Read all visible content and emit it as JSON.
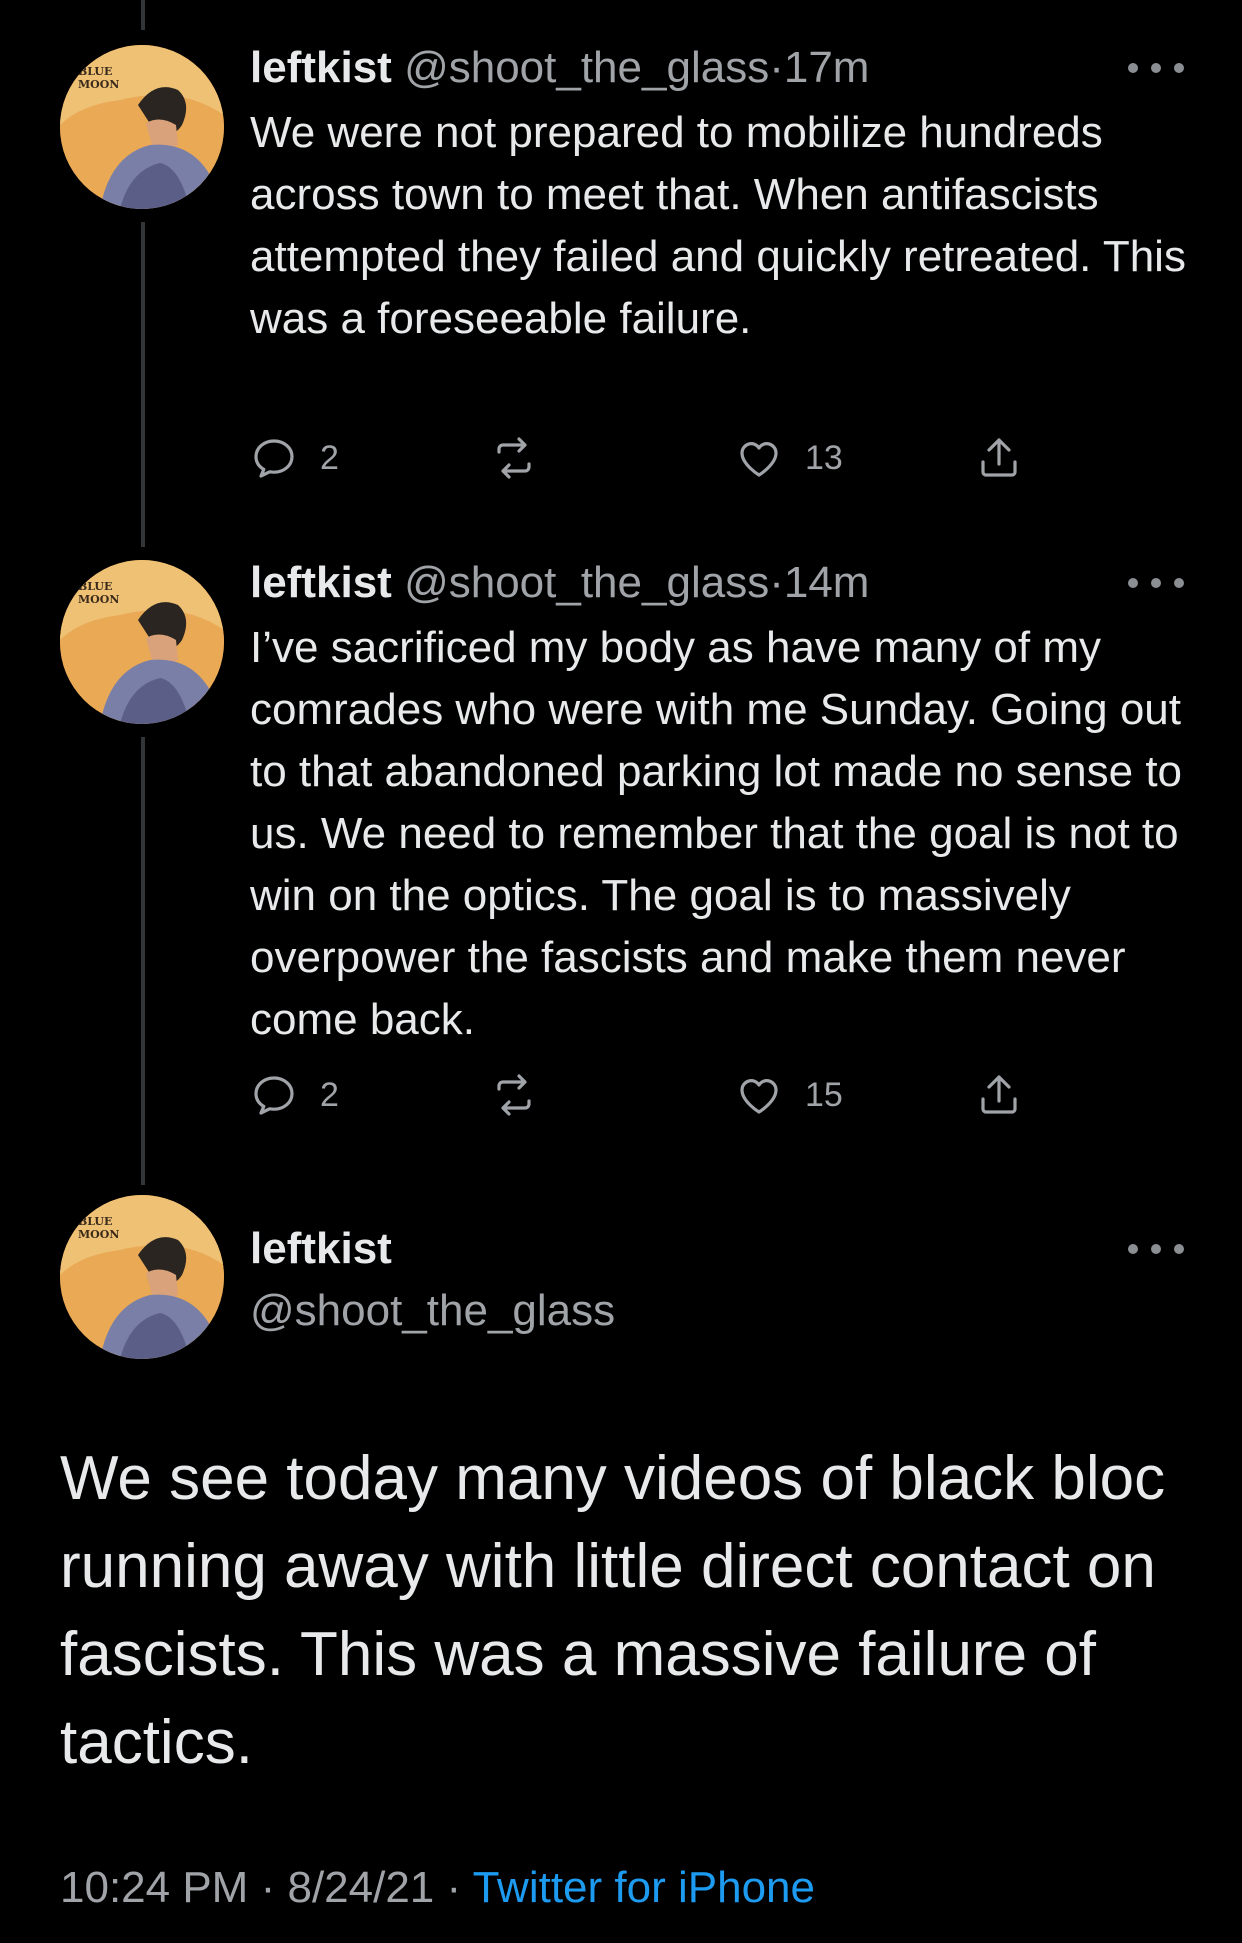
{
  "tweets": [
    {
      "name": "leftkist",
      "handle": "@shoot_the_glass",
      "separator": "·",
      "time": "17m",
      "text": "We were not prepared to mobilize hundreds across town to meet that. When antifascists attempted they failed and quickly retreated. This was a foreseeable failure.",
      "replies": "2",
      "retweets": "",
      "likes": "13"
    },
    {
      "name": "leftkist",
      "handle": "@shoot_the_glass",
      "separator": "·",
      "time": "14m",
      "text": "I’ve sacrificed my body as have many of my comrades who were with me Sunday. Going out to that abandoned parking lot made no sense to us. We need to remember that the goal is not to win on the optics. The goal is to massively overpower the fascists and make them never come back.",
      "replies": "2",
      "retweets": "",
      "likes": "15"
    }
  ],
  "main_tweet": {
    "name": "leftkist",
    "handle": "@shoot_the_glass",
    "text": "We see today many videos of black bloc running away with little direct contact on fascists. This was a massive failure of tactics.",
    "time": "10:24 PM",
    "separator_1": "·",
    "date": "8/24/21",
    "separator_2": "·",
    "source": "Twitter for iPhone"
  },
  "avatar": {
    "label_line_1": "BLUE",
    "label_line_2": "MOON"
  },
  "icons": {
    "reply": "reply-icon",
    "retweet": "retweet-icon",
    "like": "heart-icon",
    "share": "share-icon",
    "more": "more-icon"
  },
  "colors": {
    "background": "#000000",
    "text": "#e7e9ea",
    "secondary": "#a0a4a8",
    "link": "#1d9bf0",
    "thread_line": "#333639"
  }
}
